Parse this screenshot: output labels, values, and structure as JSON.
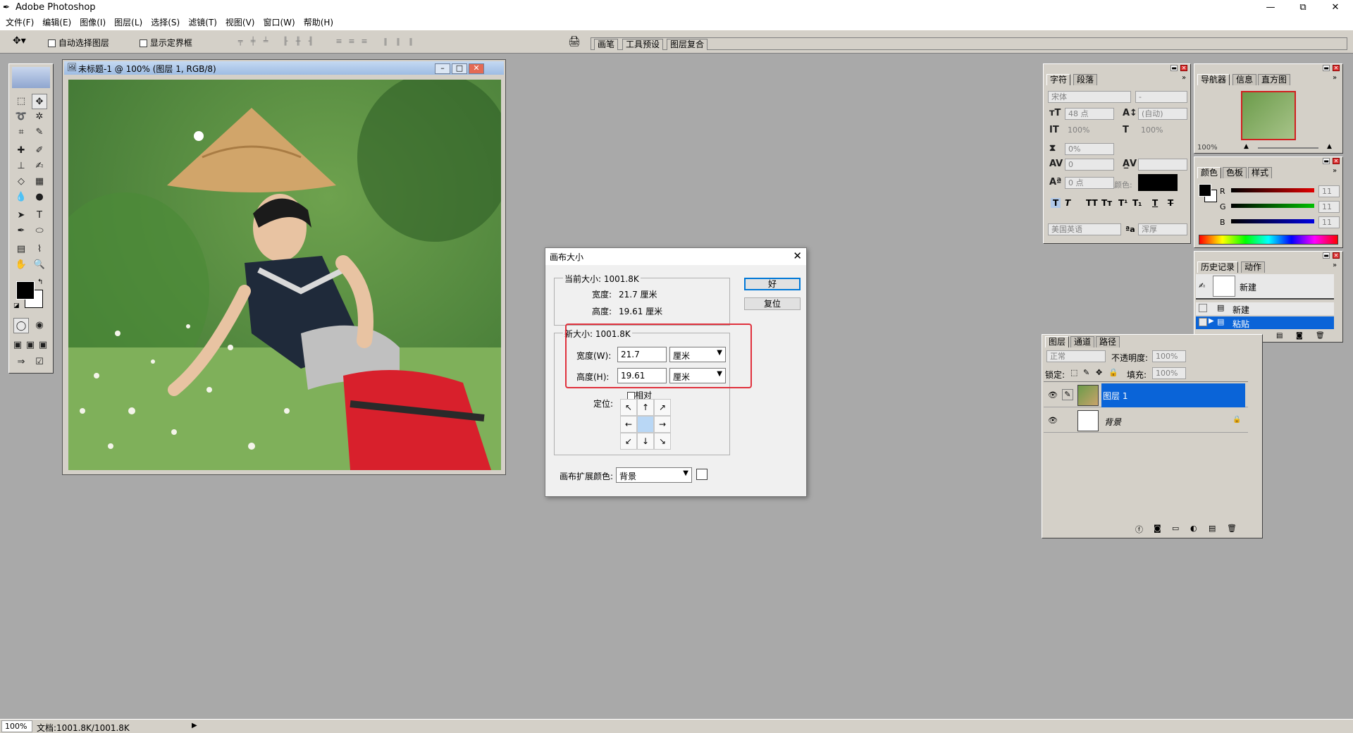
{
  "app": {
    "title": "Adobe Photoshop",
    "window_controls": {
      "minimize": "—",
      "restore": "⧉",
      "close": "✕"
    }
  },
  "menu": [
    "文件(F)",
    "编辑(E)",
    "图像(I)",
    "图层(L)",
    "选择(S)",
    "滤镜(T)",
    "视图(V)",
    "窗口(W)",
    "帮助(H)"
  ],
  "options_bar": {
    "auto_select_layer": "自动选择图层",
    "show_bounding_box": "显示定界框",
    "well_tabs": [
      "画笔",
      "工具预设",
      "图层复合"
    ]
  },
  "document": {
    "title": "未标题-1 @ 100% (图层 1, RGB/8)"
  },
  "dialog": {
    "title": "画布大小",
    "current_size_label": "当前大小: 1001.8K",
    "current_width_label": "宽度:",
    "current_width_value": "21.7 厘米",
    "current_height_label": "高度:",
    "current_height_value": "19.61 厘米",
    "new_size_label": "新大小: 1001.8K",
    "width_label": "宽度(W):",
    "width_value": "21.7",
    "width_unit": "厘米",
    "height_label": "高度(H):",
    "height_value": "19.61",
    "height_unit": "厘米",
    "relative_label": "相对",
    "anchor_label": "定位:",
    "anchor_arrows": [
      "↖",
      "↑",
      "↗",
      "←",
      "",
      "→",
      "↙",
      "↓",
      "↘"
    ],
    "extension_color_label": "画布扩展颜色:",
    "extension_color_value": "背景",
    "ok_label": "好",
    "reset_label": "复位"
  },
  "character_panel": {
    "tabs": [
      "字符",
      "段落"
    ],
    "font_family": "宋体",
    "font_style": "-",
    "font_size": "48 点",
    "leading": "(自动)",
    "vertical_scale": "100%",
    "horizontal_scale": "100%",
    "tsume": "0%",
    "kerning": "0",
    "baseline_shift": "0 点",
    "color_label": "颜色:",
    "language": "美国英语",
    "antialias": "浑厚"
  },
  "navigator_panel": {
    "tabs": [
      "导航器",
      "信息",
      "直方图"
    ],
    "zoom": "100%"
  },
  "color_panel": {
    "tabs": [
      "颜色",
      "色板",
      "样式"
    ],
    "channels": [
      {
        "label": "R",
        "value": "11",
        "color": "#e00000"
      },
      {
        "label": "G",
        "value": "11",
        "color": "#00c000"
      },
      {
        "label": "B",
        "value": "11",
        "color": "#0000e0"
      }
    ]
  },
  "history_panel": {
    "tabs": [
      "历史记录",
      "动作"
    ],
    "snapshot": "新建",
    "items": [
      "新建",
      "粘贴"
    ]
  },
  "layers_panel": {
    "tabs": [
      "图层",
      "通道",
      "路径"
    ],
    "blend_mode": "正常",
    "opacity_label": "不透明度:",
    "opacity_value": "100%",
    "lock_label": "锁定:",
    "fill_label": "填充:",
    "fill_value": "100%",
    "layers": [
      {
        "name": "图层 1",
        "selected": true
      },
      {
        "name": "背景",
        "selected": false
      }
    ]
  },
  "status_bar": {
    "zoom": "100%",
    "doc_info": "文档:1001.8K/1001.8K"
  }
}
